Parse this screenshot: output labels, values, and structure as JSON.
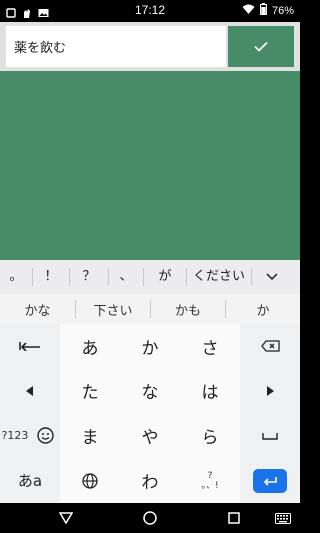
{
  "status_bar": {
    "time": "17:12",
    "battery": "76%"
  },
  "input": {
    "value": "薬を飲む"
  },
  "keyboard": {
    "punctuation": [
      "。",
      "！",
      "？",
      "、",
      "が",
      "ください"
    ],
    "suggestions": [
      "かな",
      "下さい",
      "かも",
      "か"
    ],
    "kana_rows": [
      [
        "あ",
        "か",
        "さ"
      ],
      [
        "た",
        "な",
        "は"
      ],
      [
        "ま",
        "や",
        "ら"
      ],
      [
        "",
        "わ",
        ""
      ]
    ],
    "mode_key": "?123",
    "lang_key": "あa",
    "punct_key_top": "?",
    "punct_key_bottom": "。、!"
  },
  "colors": {
    "accent": "#468c66",
    "enter": "#1a73e8"
  }
}
